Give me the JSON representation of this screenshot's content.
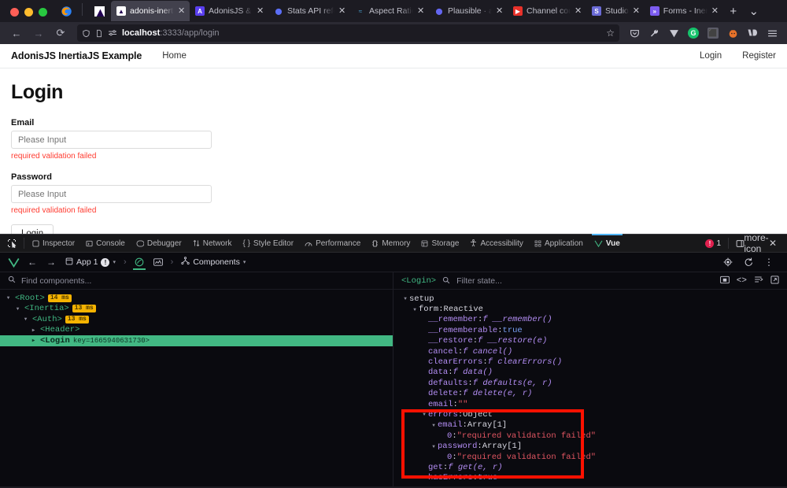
{
  "browser": {
    "window_controls": [
      "close",
      "minimize",
      "maximize"
    ],
    "tabs": [
      {
        "title": "adonis-inertia-ex",
        "favicon": "adonis-icon",
        "active": true
      },
      {
        "title": "AdonisJS & JavaS",
        "favicon": "adonisjs-icon",
        "active": false
      },
      {
        "title": "Stats API referenc",
        "favicon": "stats-icon",
        "active": false
      },
      {
        "title": "Aspect Ratio - Ta",
        "favicon": "aspect-ratio-icon",
        "active": false
      },
      {
        "title": "Plausible · adocas",
        "favicon": "plausible-icon",
        "active": false
      },
      {
        "title": "Channel content",
        "favicon": "youtube-icon",
        "active": false
      },
      {
        "title": "Studio",
        "favicon": "studio-icon",
        "active": false
      },
      {
        "title": "Forms - Inertia.js",
        "favicon": "inertia-icon",
        "active": false
      }
    ],
    "new_tab_label": "+",
    "tab_list_label": "⌄",
    "nav": {
      "back": "←",
      "forward": "→",
      "reload": "⟳",
      "url_host": "localhost",
      "url_path": ":3333/app/login",
      "bookmark": "☆"
    },
    "toolbar_icons": [
      "pocket-icon",
      "wrench-icon",
      "vue-devtools-icon",
      "grammarly-icon",
      "extension-icon",
      "firefox-account-icon",
      "vimium-icon",
      "menu-icon"
    ]
  },
  "webpage": {
    "navbar": {
      "brand": "AdonisJS InertiaJS Example",
      "home": "Home",
      "login": "Login",
      "register": "Register"
    },
    "title": "Login",
    "fields": [
      {
        "label": "Email",
        "value": "",
        "placeholder": "Please Input",
        "error": "required validation failed"
      },
      {
        "label": "Password",
        "value": "",
        "placeholder": "Please Input",
        "error": "required validation failed"
      }
    ],
    "submit_label": "Login"
  },
  "devtools": {
    "picker_icon": "element-picker-icon",
    "tabs": [
      {
        "label": "Inspector",
        "icon": "inspector-icon",
        "active": false
      },
      {
        "label": "Console",
        "icon": "console-icon",
        "active": false
      },
      {
        "label": "Debugger",
        "icon": "debugger-icon",
        "active": false
      },
      {
        "label": "Network",
        "icon": "network-icon",
        "active": false
      },
      {
        "label": "Style Editor",
        "icon": "style-editor-icon",
        "active": false
      },
      {
        "label": "Performance",
        "icon": "performance-icon",
        "active": false
      },
      {
        "label": "Memory",
        "icon": "memory-icon",
        "active": false
      },
      {
        "label": "Storage",
        "icon": "storage-icon",
        "active": false
      },
      {
        "label": "Accessibility",
        "icon": "accessibility-icon",
        "active": false
      },
      {
        "label": "Application",
        "icon": "application-icon",
        "active": false
      },
      {
        "label": "Vue",
        "icon": "vue-icon",
        "active": true
      }
    ],
    "error_count": "1",
    "dock_icon": "dock-icon",
    "more_icon": "more-icon",
    "close_icon": "close-icon"
  },
  "vue_devtools": {
    "toolbar": {
      "logo": "vue-logo-icon",
      "back": "←",
      "forward": "→",
      "app_selector": "App 1",
      "app_warning": "!",
      "app_chevron": "▾",
      "separator": "›",
      "active_view_icon": "instance-icon",
      "timeline_icon": "timeline-icon",
      "panel_icon": "components-tree-icon",
      "panel_label": "Components",
      "panel_chevron": "▾",
      "inspect_icon": "target-icon",
      "refresh_icon": "refresh-icon",
      "kebab_icon": "kebab-icon"
    },
    "components_panel": {
      "search_placeholder": "Find components...",
      "search_value": "",
      "tree": [
        {
          "name": "<Root>",
          "depth": 0,
          "badge": "14 ms",
          "expanded": true,
          "selected": false,
          "key": ""
        },
        {
          "name": "<Inertia>",
          "depth": 1,
          "badge": "13 ms",
          "expanded": true,
          "selected": false,
          "key": ""
        },
        {
          "name": "<Auth>",
          "depth": 2,
          "badge": "13 ms",
          "expanded": true,
          "selected": false,
          "key": ""
        },
        {
          "name": "<Header>",
          "depth": 3,
          "badge": "",
          "expanded": false,
          "selected": false,
          "key": ""
        },
        {
          "name": "<Login",
          "depth": 3,
          "badge": "",
          "expanded": false,
          "selected": true,
          "key": "key=1665940631730>"
        }
      ]
    },
    "state_panel": {
      "component_name": "<Login>",
      "filter_placeholder": "Filter state...",
      "filter_value": "",
      "actions": [
        "open-in-editor-icon",
        "code-icon",
        "sort-icon",
        "popout-icon"
      ],
      "rows": [
        {
          "indent": 0,
          "caret": "▾",
          "key": "setup",
          "sep": "",
          "value": "",
          "vtype": "none"
        },
        {
          "indent": 1,
          "caret": "▾",
          "key": "form",
          "sep": ": ",
          "value": "Reactive",
          "vtype": "name"
        },
        {
          "indent": 2,
          "caret": "",
          "key": "__remember",
          "sep": ": ",
          "value": "f __remember()",
          "vtype": "fn"
        },
        {
          "indent": 2,
          "caret": "",
          "key": "__rememberable",
          "sep": ": ",
          "value": "true",
          "vtype": "bool"
        },
        {
          "indent": 2,
          "caret": "",
          "key": "__restore",
          "sep": ": ",
          "value": "f __restore(e)",
          "vtype": "fn"
        },
        {
          "indent": 2,
          "caret": "",
          "key": "cancel",
          "sep": ": ",
          "value": "f cancel()",
          "vtype": "fn"
        },
        {
          "indent": 2,
          "caret": "",
          "key": "clearErrors",
          "sep": ": ",
          "value": "f clearErrors()",
          "vtype": "fn"
        },
        {
          "indent": 2,
          "caret": "",
          "key": "data",
          "sep": ": ",
          "value": "f data()",
          "vtype": "fn"
        },
        {
          "indent": 2,
          "caret": "",
          "key": "defaults",
          "sep": ": ",
          "value": "f defaults(e, r)",
          "vtype": "fn"
        },
        {
          "indent": 2,
          "caret": "",
          "key": "delete",
          "sep": ": ",
          "value": "f delete(e, r)",
          "vtype": "fn"
        },
        {
          "indent": 2,
          "caret": "",
          "key": "email",
          "sep": ": ",
          "value": "\"\"",
          "vtype": "str"
        },
        {
          "indent": 2,
          "caret": "▾",
          "key": "errors",
          "sep": ": ",
          "value": "Object",
          "vtype": "name"
        },
        {
          "indent": 3,
          "caret": "▾",
          "key": "email",
          "sep": ": ",
          "value": "Array[1]",
          "vtype": "name"
        },
        {
          "indent": 4,
          "caret": "",
          "key": "0",
          "sep": ": ",
          "value": "\"required validation failed\"",
          "vtype": "str"
        },
        {
          "indent": 3,
          "caret": "▾",
          "key": "password",
          "sep": ": ",
          "value": "Array[1]",
          "vtype": "name"
        },
        {
          "indent": 4,
          "caret": "",
          "key": "0",
          "sep": ": ",
          "value": "\"required validation failed\"",
          "vtype": "str"
        },
        {
          "indent": 2,
          "caret": "",
          "key": "get",
          "sep": ": ",
          "value": "f get(e, r)",
          "vtype": "fn"
        },
        {
          "indent": 2,
          "caret": "",
          "key": "hasErrors",
          "sep": ": ",
          "value": "true",
          "vtype": "bool"
        }
      ],
      "highlight_annotation": {
        "color": "#ff1100",
        "label": "errors-highlight-box"
      }
    }
  },
  "colors": {
    "chrome_bg": "#1c1b22",
    "navbar_bg": "#2b2a33",
    "devtools_bg": "#0c0c0d",
    "vue_green": "#41b883",
    "error_red": "#ff3b30",
    "highlight_red": "#ff1100",
    "badge_yellow": "#f5b301"
  }
}
